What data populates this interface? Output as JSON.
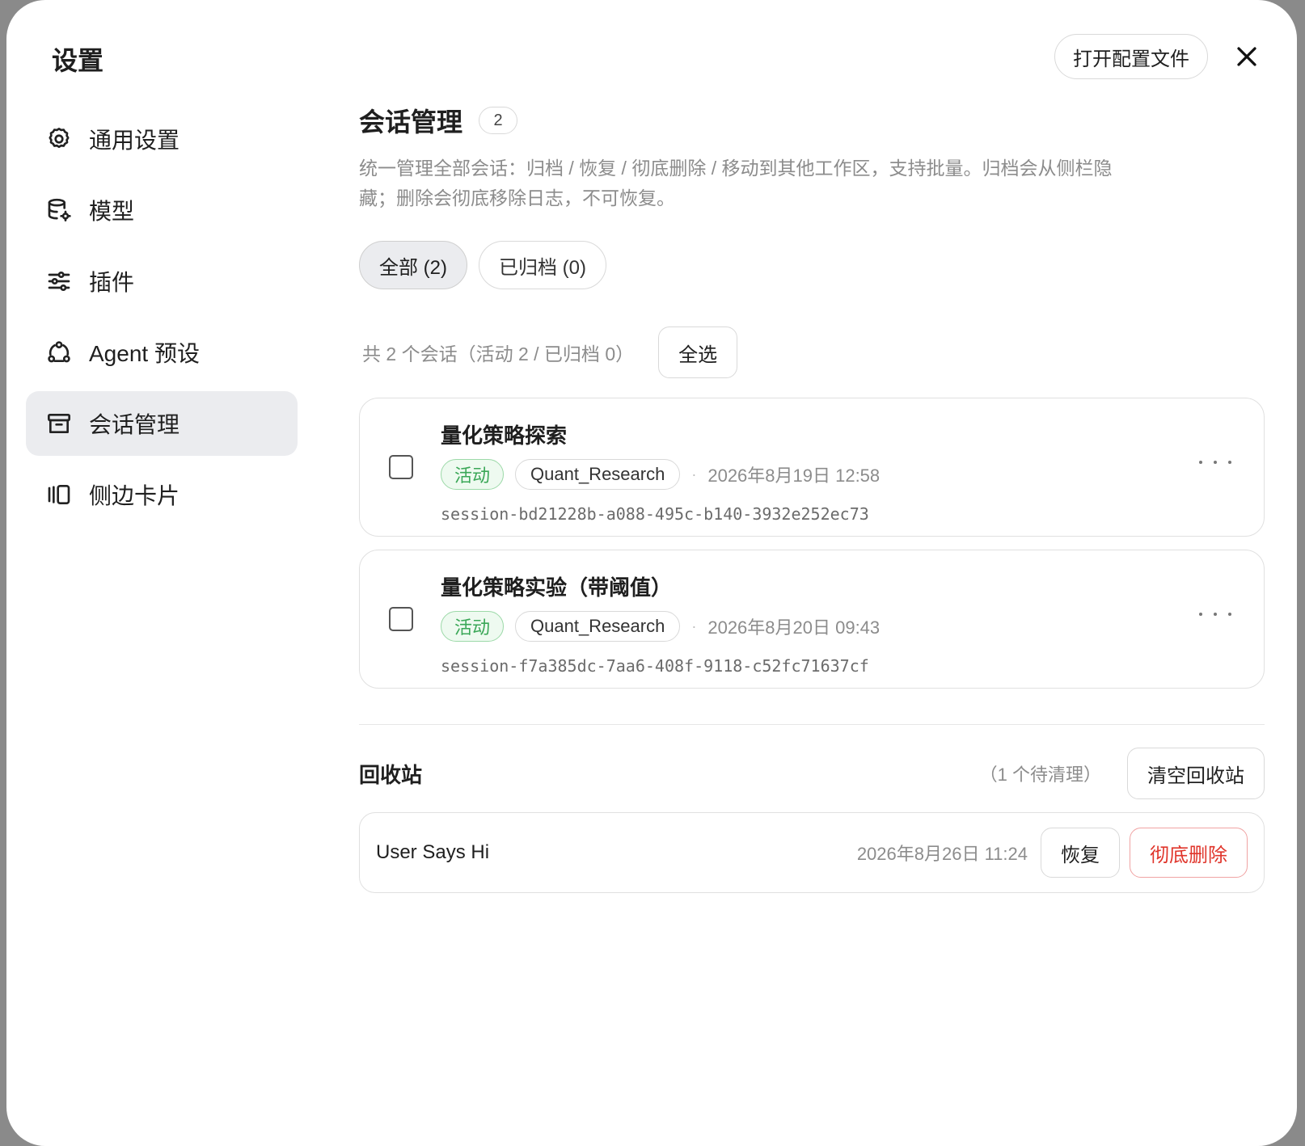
{
  "header": {
    "title": "设置",
    "open_config_label": "打开配置文件"
  },
  "sidebar": {
    "items": [
      {
        "label": "通用设置",
        "icon": "gear-icon"
      },
      {
        "label": "模型",
        "icon": "database-gear-icon"
      },
      {
        "label": "插件",
        "icon": "sliders-icon"
      },
      {
        "label": "Agent 预设",
        "icon": "agent-network-icon"
      },
      {
        "label": "会话管理",
        "icon": "archive-box-icon",
        "active": true
      },
      {
        "label": "侧边卡片",
        "icon": "side-cards-icon"
      }
    ]
  },
  "main": {
    "title": "会话管理",
    "count": "2",
    "description": "统一管理全部会话：归档 / 恢复 / 彻底删除 / 移动到其他工作区，支持批量。归档会从侧栏隐藏；删除会彻底移除日志，不可恢复。",
    "filters": [
      {
        "label": "全部 (2)",
        "active": true
      },
      {
        "label": "已归档 (0)",
        "active": false
      }
    ],
    "summary": "共 2 个会话（活动 2 / 已归档 0）",
    "select_all_label": "全选",
    "sessions": [
      {
        "title": "量化策略探索",
        "status": "活动",
        "workspace": "Quant_Research",
        "date": "2026年8月19日 12:58",
        "id": "session-bd21228b-a088-495c-b140-3932e252ec73"
      },
      {
        "title": "量化策略实验（带阈值）",
        "status": "活动",
        "workspace": "Quant_Research",
        "date": "2026年8月20日 09:43",
        "id": "session-f7a385dc-7aa6-408f-9118-c52fc71637cf"
      }
    ]
  },
  "trash": {
    "title": "回收站",
    "count_text": "（1 个待清理）",
    "empty_label": "清空回收站",
    "items": [
      {
        "name": "User Says Hi",
        "date": "2026年8月26日 11:24",
        "restore_label": "恢复",
        "delete_label": "彻底删除"
      }
    ]
  },
  "colors": {
    "active_tag": "#3aa757",
    "danger": "#e0352b",
    "sidebar_active_bg": "#ebecef"
  }
}
